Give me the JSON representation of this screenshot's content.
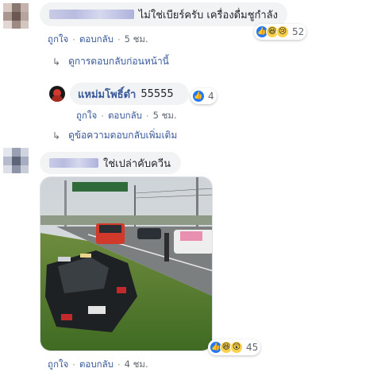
{
  "comment1": {
    "text": "ไม่ใช่เบียร์ครับ เครื่องดื่มชูกำลัง",
    "like_label": "ถูกใจ",
    "reply_label": "ตอบกลับ",
    "time": "5 ชม.",
    "reactions": [
      "like-icon",
      "haha-icon",
      "sad-icon"
    ],
    "reaction_count": "52",
    "previous_replies_link": "ดูการตอบกลับก่อนหน้านี้"
  },
  "reply1": {
    "author": "แหม่มโพธิ์ดำ",
    "text": "55555",
    "like_label": "ถูกใจ",
    "reply_label": "ตอบกลับ",
    "time": "5 ชม.",
    "reactions": [
      "like-icon"
    ],
    "reaction_count": "4",
    "more_replies_link": "ดูข้อความตอบกลับเพิ่มเติม"
  },
  "comment2": {
    "text": "ใช่เปล่าคับควีน",
    "like_label": "ถูกใจ",
    "reply_label": "ตอบกลับ",
    "time": "4 ชม.",
    "reactions": [
      "like-icon",
      "haha-icon",
      "wow-icon"
    ],
    "reaction_count": "45"
  },
  "colors": {
    "link": "#385898",
    "bubble": "#f2f3f5",
    "meta": "#606770",
    "like_blue": "#2078f4"
  }
}
